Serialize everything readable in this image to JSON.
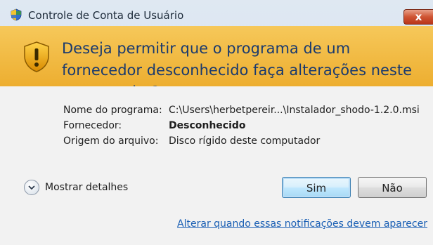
{
  "window": {
    "title": "Controle de Conta de Usuário",
    "close_label": "x"
  },
  "prompt": {
    "question": "Deseja permitir que o programa de um fornecedor desconhecido faça alterações neste computador?"
  },
  "details": {
    "program_label": "Nome do programa:",
    "program_value": "C:\\Users\\herbetpereir...\\Instalador_shodo-1.2.0.msi",
    "publisher_label": "Fornecedor:",
    "publisher_value": "Desconhecido",
    "origin_label": "Origem do arquivo:",
    "origin_value": "Disco rígido deste computador"
  },
  "actions": {
    "show_details_label": "Mostrar detalhes",
    "yes_label": "Sim",
    "no_label": "Não"
  },
  "footer": {
    "link_text": "Alterar quando essas notificações devem aparecer"
  },
  "colors": {
    "warning_band": "#f0b23a",
    "link": "#1a5fb4",
    "headline": "#1a3a6e"
  },
  "icons": {
    "title": "uac-shield-icon",
    "warning": "warning-shield-icon",
    "expand": "chevron-down-icon"
  }
}
